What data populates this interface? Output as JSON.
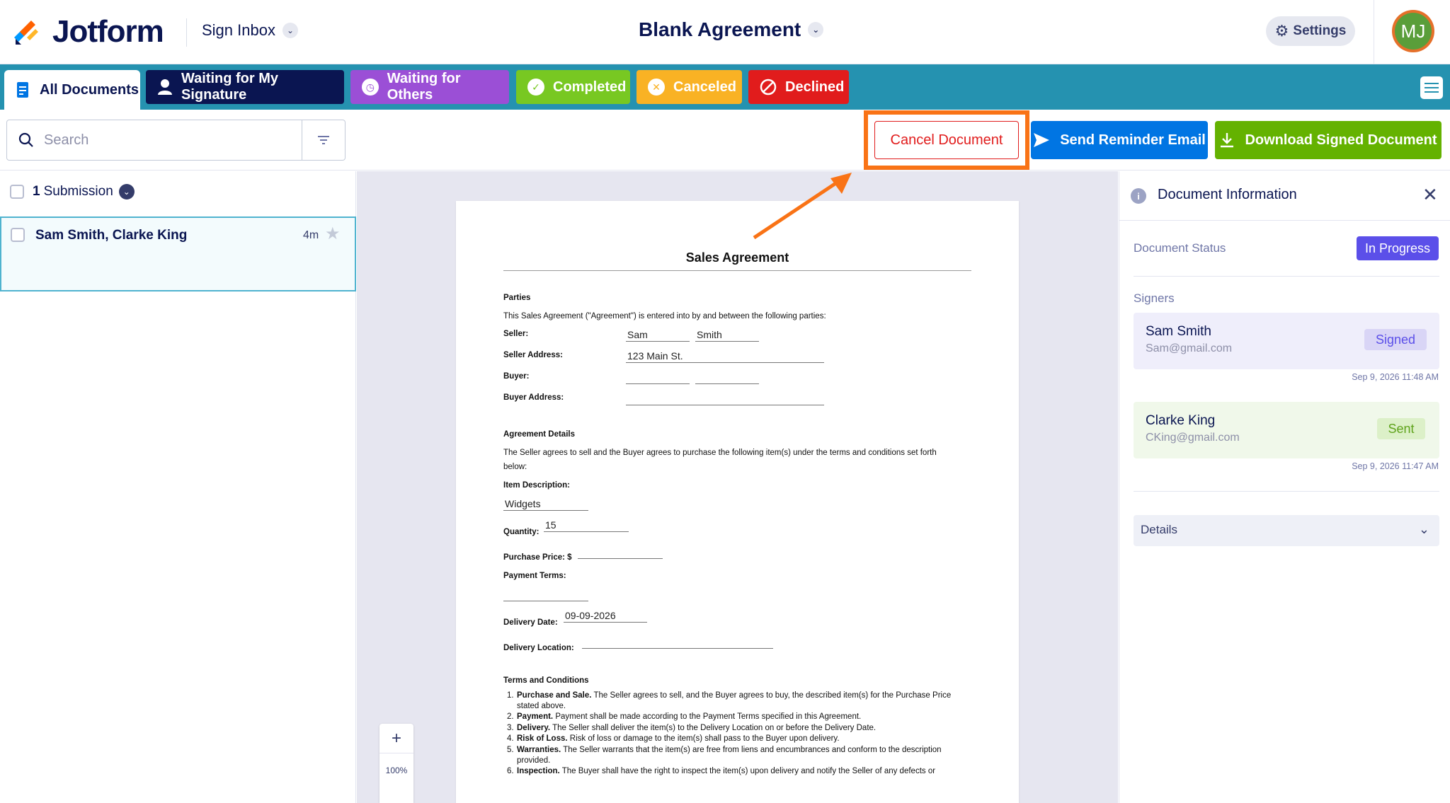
{
  "header": {
    "brand": "Jotform",
    "inbox_label": "Sign Inbox",
    "document_title": "Blank Agreement",
    "settings_label": "Settings",
    "avatar_initials": "MJ"
  },
  "tabs": [
    {
      "label": "All Documents",
      "icon": "document-icon",
      "active": true
    },
    {
      "label": "Waiting for My Signature",
      "icon": "user-icon",
      "color": "#0a1551"
    },
    {
      "label": "Waiting for Others",
      "icon": "clock-icon",
      "color": "#9b4fd6"
    },
    {
      "label": "Completed",
      "icon": "check-circle-icon",
      "color": "#78c822"
    },
    {
      "label": "Canceled",
      "icon": "x-circle-icon",
      "color": "#f9b224"
    },
    {
      "label": "Declined",
      "icon": "ban-icon",
      "color": "#e11c1c"
    }
  ],
  "toolbar": {
    "search_placeholder": "Search",
    "cancel_label": "Cancel Document",
    "remind_label": "Send Reminder Email",
    "download_label": "Download Signed Document"
  },
  "list": {
    "count": "1",
    "count_label": "Submission",
    "items": [
      {
        "name": "Sam Smith, Clarke King",
        "time": "4m",
        "starred": false
      }
    ]
  },
  "document": {
    "title": "Sales Agreement",
    "parties_heading": "Parties",
    "parties_text": "This Sales Agreement (\"Agreement\") is entered into by and between the following parties:",
    "seller_label": "Seller:",
    "seller_first": "Sam",
    "seller_last": "Smith",
    "seller_address_label": "Seller Address:",
    "seller_address": "123 Main St.",
    "buyer_label": "Buyer:",
    "buyer_address_label": "Buyer Address:",
    "agreement_heading": "Agreement Details",
    "agreement_text_1": "The Seller agrees to sell and the Buyer agrees to purchase the following item(s) under the terms and conditions set forth",
    "agreement_text_2": "below:",
    "item_desc_label": "Item Description:",
    "item_desc": "Widgets",
    "quantity_label": "Quantity:",
    "quantity": "15",
    "price_label": "Purchase Price: $",
    "payment_terms_label": "Payment Terms:",
    "delivery_date_label": "Delivery Date:",
    "delivery_date": "09-09-2026",
    "delivery_location_label": "Delivery Location:",
    "terms_heading": "Terms and Conditions",
    "terms": [
      {
        "num": "1.",
        "bold": "Purchase and Sale.",
        "text": " The Seller agrees to sell, and the Buyer agrees to buy, the described item(s) for the Purchase Price"
      },
      {
        "num": "",
        "bold": "",
        "text": "stated above."
      },
      {
        "num": "2.",
        "bold": "Payment.",
        "text": " Payment shall be made according to the Payment Terms specified in this Agreement."
      },
      {
        "num": "3.",
        "bold": "Delivery.",
        "text": " The Seller shall deliver the item(s) to the Delivery Location on or before the Delivery Date."
      },
      {
        "num": "4.",
        "bold": "Risk of Loss.",
        "text": " Risk of loss or damage to the item(s) shall pass to the Buyer upon delivery."
      },
      {
        "num": "5.",
        "bold": "Warranties.",
        "text": " The Seller warrants that the item(s) are free from liens and encumbrances and conform to the description"
      },
      {
        "num": "",
        "bold": "",
        "text": "provided."
      },
      {
        "num": "6.",
        "bold": "Inspection.",
        "text": " The Buyer shall have the right to inspect the item(s) upon delivery and notify the Seller of any defects or"
      }
    ],
    "zoom_level": "100%"
  },
  "info_panel": {
    "title": "Document Information",
    "status_label": "Document Status",
    "status_value": "In Progress",
    "signers_label": "Signers",
    "signers": [
      {
        "name": "Sam Smith",
        "email": "Sam@gmail.com",
        "status": "Signed",
        "timestamp": "Sep 9, 2026 11:48 AM"
      },
      {
        "name": "Clarke King",
        "email": "CKing@gmail.com",
        "status": "Sent",
        "timestamp": "Sep 9, 2026 11:47 AM"
      }
    ],
    "details_label": "Details"
  },
  "colors": {
    "tabbar": "#2592b0",
    "highlight": "#f97316",
    "cancel": "#e11c1c",
    "remind": "#0075e3",
    "download": "#64b200",
    "in_progress": "#5b4fe9"
  }
}
